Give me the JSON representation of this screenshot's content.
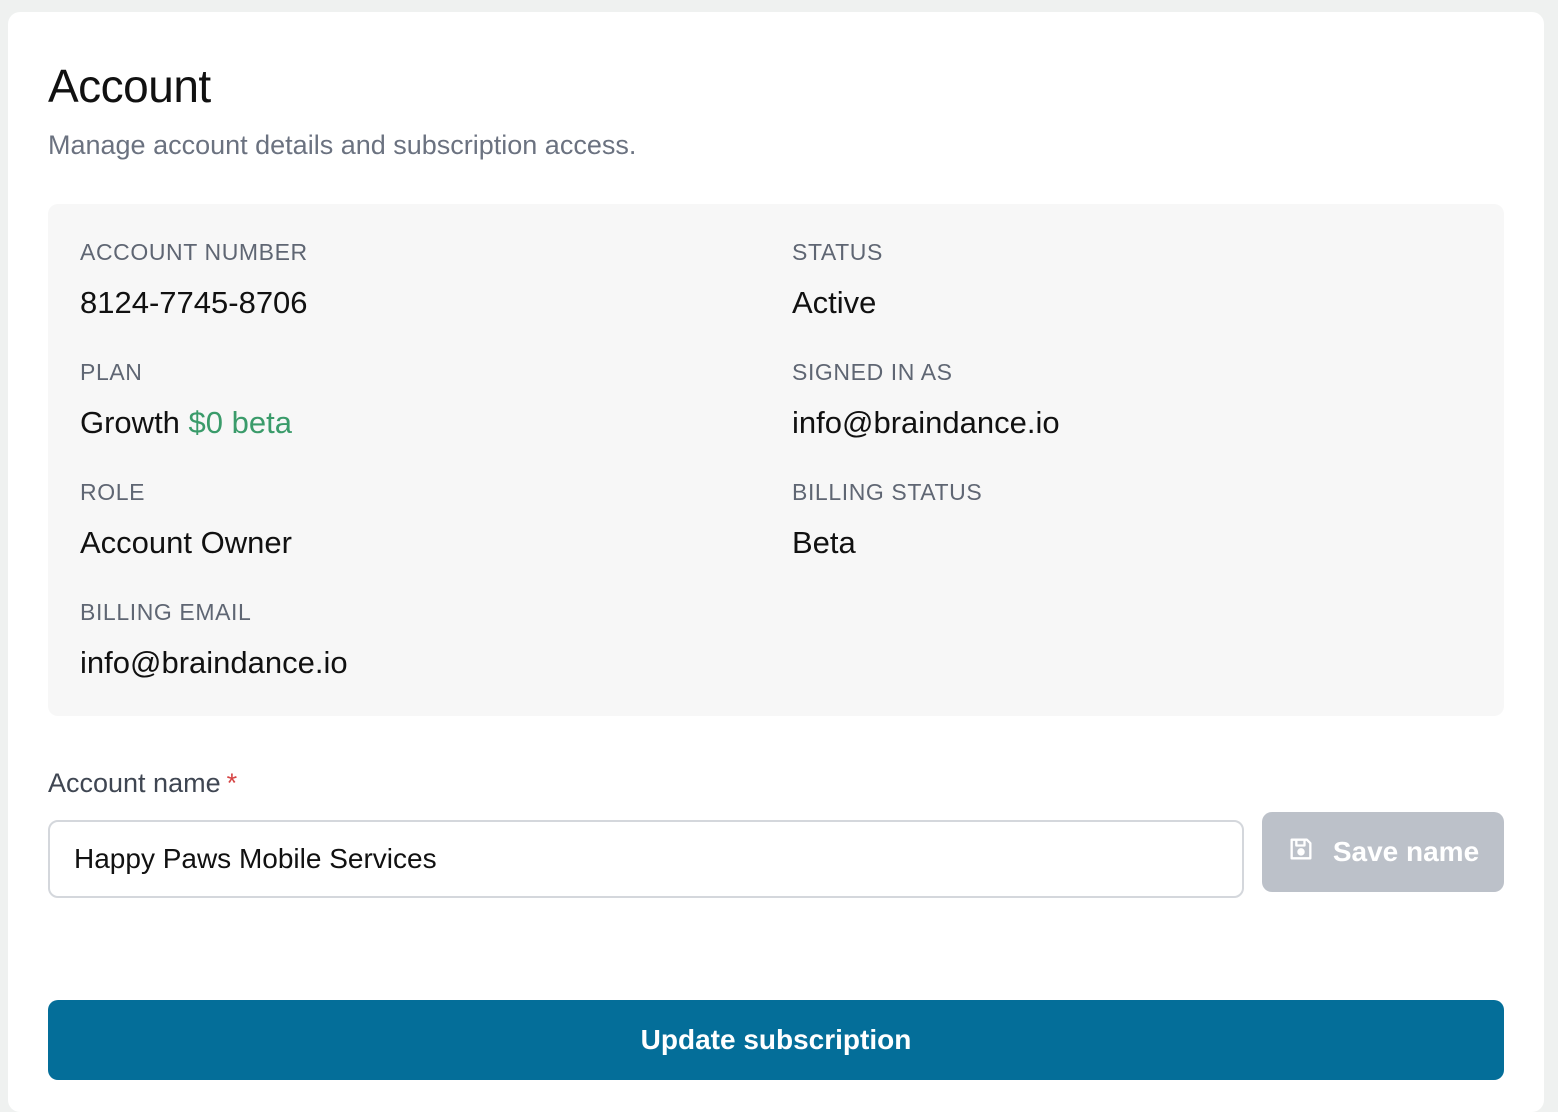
{
  "header": {
    "title": "Account",
    "subtitle": "Manage account details and subscription access."
  },
  "details": {
    "account_number": {
      "label": "ACCOUNT NUMBER",
      "value": "8124-7745-8706"
    },
    "status": {
      "label": "STATUS",
      "value": "Active"
    },
    "plan": {
      "label": "PLAN",
      "value": "Growth",
      "price": "$0 beta"
    },
    "signed_in_as": {
      "label": "SIGNED IN AS",
      "value": "info@braindance.io"
    },
    "role": {
      "label": "ROLE",
      "value": "Account Owner"
    },
    "billing_status": {
      "label": "BILLING STATUS",
      "value": "Beta"
    },
    "billing_email": {
      "label": "BILLING EMAIL",
      "value": "info@braindance.io"
    }
  },
  "account_name": {
    "label": "Account name",
    "required_marker": "*",
    "value": "Happy Paws Mobile Services",
    "save_label": "Save name",
    "save_icon": "floppy-disk-icon",
    "save_disabled": true
  },
  "actions": {
    "update_subscription_label": "Update subscription"
  },
  "colors": {
    "primary": "#046e99",
    "accent_green": "#3a9b6a",
    "required_red": "#d64545",
    "disabled_button": "#bcc1c9"
  }
}
